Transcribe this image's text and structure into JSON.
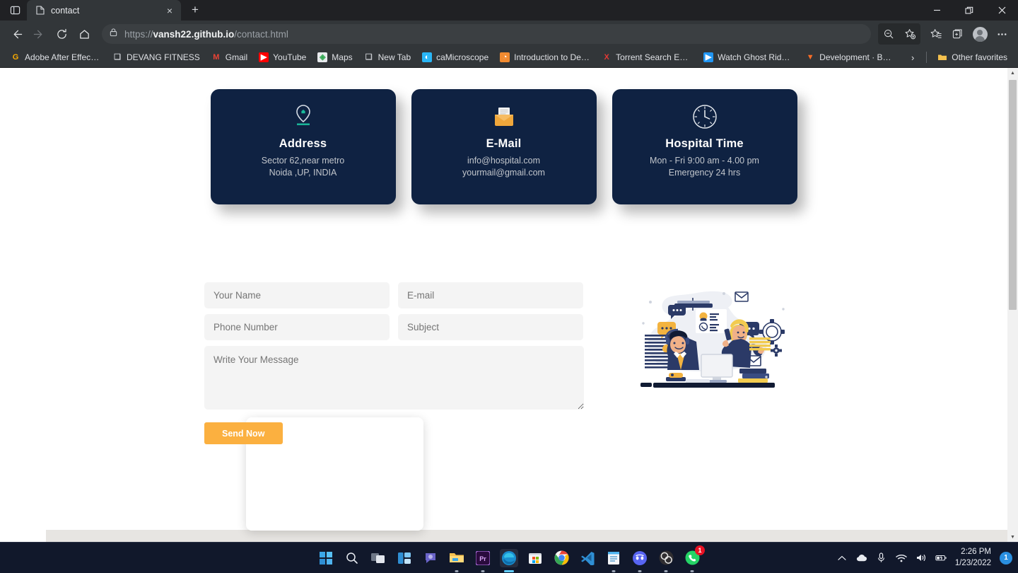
{
  "browser": {
    "tab": {
      "title": "contact",
      "favicon": "document-icon",
      "close_label": "×"
    },
    "new_tab_label": "+",
    "tab_search_icon": "tab-search-icon",
    "window_controls": {
      "minimize": "—",
      "restore": "❐",
      "close": "✕"
    },
    "nav": {
      "back": "←",
      "forward": "→",
      "reload": "⟳",
      "home": "⌂"
    },
    "address": {
      "lock_icon": "lock-icon",
      "url_scheme": "https://",
      "url_host": "vansh22.github.io",
      "url_path": "/contact.html",
      "full_url": "https://vansh22.github.io/contact.html"
    },
    "toolbar_right": [
      {
        "name": "zoom-out-icon",
        "glyph": "⊖"
      },
      {
        "name": "add-favorite-icon",
        "glyph": "☆"
      },
      {
        "name": "favorites-icon",
        "glyph": "☆"
      },
      {
        "name": "collections-icon",
        "glyph": "⧉"
      },
      {
        "name": "profile-avatar",
        "glyph": ""
      },
      {
        "name": "settings-and-more-icon",
        "glyph": "⋯"
      }
    ],
    "bookmarks": [
      {
        "label": "Adobe After Effects...",
        "icon": "G",
        "icon_color": "#f9ab00",
        "icon_bg": "transparent"
      },
      {
        "label": "DEVANG FITNESS",
        "icon": "❑",
        "icon_color": "#c8cbd0",
        "icon_bg": "transparent"
      },
      {
        "label": "Gmail",
        "icon": "M",
        "icon_color": "#ea4335",
        "icon_bg": "transparent"
      },
      {
        "label": "YouTube",
        "icon": "▶",
        "icon_color": "#ffffff",
        "icon_bg": "#ff0000"
      },
      {
        "label": "Maps",
        "icon": "◈",
        "icon_color": "#34a853",
        "icon_bg": "#e8eaed"
      },
      {
        "label": "New Tab",
        "icon": "❑",
        "icon_color": "#c8cbd0",
        "icon_bg": "transparent"
      },
      {
        "label": "caMicroscope",
        "icon": "◐",
        "icon_color": "#ffffff",
        "icon_bg": "#29b6f6"
      },
      {
        "label": "Introduction to Dee...",
        "icon": "◔",
        "icon_color": "#ffffff",
        "icon_bg": "#f28b30"
      },
      {
        "label": "Torrent Search Engi...",
        "icon": "X",
        "icon_color": "#e53935",
        "icon_bg": "transparent"
      },
      {
        "label": "Watch Ghost Rider...",
        "icon": "▶",
        "icon_color": "#ffffff",
        "icon_bg": "#2196f3"
      },
      {
        "label": "Development · Boar...",
        "icon": "▼",
        "icon_color": "#fc6d26",
        "icon_bg": "transparent"
      }
    ],
    "bookmarks_overflow": "›",
    "other_favorites": {
      "label": "Other favorites",
      "icon": "folder-icon"
    }
  },
  "page": {
    "cards": [
      {
        "icon": "location-pin-icon",
        "title": "Address",
        "lines": [
          "Sector 62,near metro",
          "Noida ,UP, INDIA"
        ]
      },
      {
        "icon": "incoming-envelope-icon",
        "title": "E-Mail",
        "lines": [
          "info@hospital.com",
          "yourmail@gmail.com"
        ]
      },
      {
        "icon": "clock-icon",
        "title": "Hospital Time",
        "lines": [
          "Mon - Fri 9:00 am - 4.00 pm",
          "Emergency 24 hrs"
        ]
      }
    ],
    "form": {
      "name": {
        "placeholder": "Your Name",
        "value": ""
      },
      "email": {
        "placeholder": "E-mail",
        "value": ""
      },
      "phone": {
        "placeholder": "Phone Number",
        "value": ""
      },
      "subject": {
        "placeholder": "Subject",
        "value": ""
      },
      "message": {
        "placeholder": "Write Your Message",
        "value": ""
      },
      "submit_label": "Send Now"
    },
    "illustration": {
      "name": "customer-support-illustration",
      "alt": "Two support agents with headset and phone, envelopes, gears and chat bubbles"
    },
    "colors": {
      "card_bg": "#0f2242",
      "accent_orange": "#fbb040",
      "input_bg": "#f4f4f4",
      "page_bg": "#ffffff"
    }
  },
  "taskbar": {
    "items": [
      {
        "name": "start-button",
        "label": "Start",
        "running": false
      },
      {
        "name": "search-button",
        "label": "Search",
        "running": false
      },
      {
        "name": "task-view-button",
        "label": "Task View",
        "running": false
      },
      {
        "name": "widgets-button",
        "label": "Widgets",
        "running": false
      },
      {
        "name": "teams-chat-button",
        "label": "Chat",
        "running": false
      },
      {
        "name": "file-explorer-button",
        "label": "File Explorer",
        "running": true
      },
      {
        "name": "premiere-pro-button",
        "label": "Adobe Premiere Pro",
        "running": true
      },
      {
        "name": "edge-button",
        "label": "Microsoft Edge",
        "running": true,
        "active": true
      },
      {
        "name": "microsoft-store-button",
        "label": "Microsoft Store",
        "running": false
      },
      {
        "name": "chrome-button",
        "label": "Google Chrome",
        "running": false
      },
      {
        "name": "vscode-button",
        "label": "Visual Studio Code",
        "running": false
      },
      {
        "name": "notepad-button",
        "label": "Notepad",
        "running": true
      },
      {
        "name": "discord-button",
        "label": "Discord",
        "running": true
      },
      {
        "name": "obs-button",
        "label": "OBS Studio",
        "running": true
      },
      {
        "name": "whatsapp-button",
        "label": "WhatsApp",
        "running": true,
        "badge": "1"
      }
    ],
    "tray": {
      "show_hidden_icons": "∧",
      "onedrive": "onedrive-icon",
      "microphone": "microphone-icon",
      "wifi": "wifi-icon",
      "volume": "volume-icon",
      "battery": "battery-icon",
      "time": "2:26 PM",
      "date": "1/23/2022",
      "notification_count": "1"
    }
  }
}
